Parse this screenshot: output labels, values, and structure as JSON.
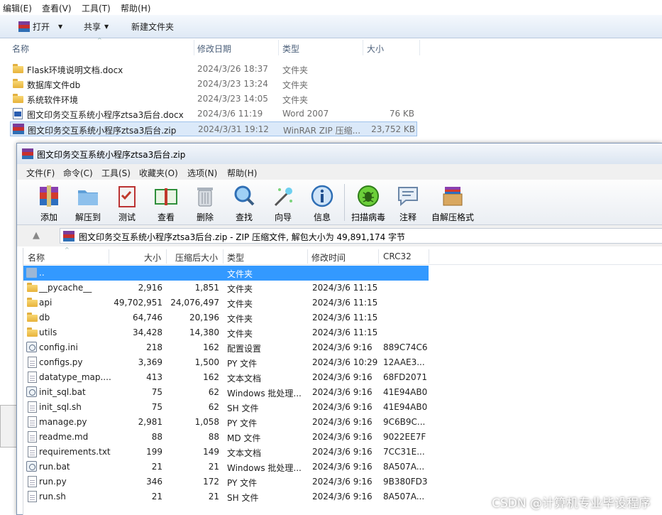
{
  "explorer": {
    "menu": [
      "编辑(E)",
      "查看(V)",
      "工具(T)",
      "帮助(H)"
    ],
    "toolbar": {
      "open": "打开",
      "share": "共享",
      "new_folder": "新建文件夹"
    },
    "columns": {
      "name": "名称",
      "date": "修改日期",
      "type": "类型",
      "size": "大小"
    },
    "rows": [
      {
        "name": "Flask环境说明文档.docx",
        "date": "2024/3/26 18:37",
        "type": "文件夹",
        "size": "",
        "icon": "folder-icon"
      },
      {
        "name": "数据库文件db",
        "date": "2024/3/23 13:24",
        "type": "文件夹",
        "size": "",
        "icon": "folder-icon"
      },
      {
        "name": "系统软件环境",
        "date": "2024/3/23 14:05",
        "type": "文件夹",
        "size": "",
        "icon": "folder-icon"
      },
      {
        "name": "图文印务交互系统小程序ztsa3后台.docx",
        "date": "2024/3/6 11:19",
        "type": "Word 2007",
        "size": "76 KB",
        "icon": "word-doc-icon"
      },
      {
        "name": "图文印务交互系统小程序ztsa3后台.zip",
        "date": "2024/3/31 19:12",
        "type": "WinRAR ZIP 压缩...",
        "size": "23,752 KB",
        "icon": "winrar-zip-icon"
      }
    ]
  },
  "winrar": {
    "title": "图文印务交互系统小程序ztsa3后台.zip",
    "menu": [
      "文件(F)",
      "命令(C)",
      "工具(S)",
      "收藏夹(O)",
      "选项(N)",
      "帮助(H)"
    ],
    "tools": [
      "添加",
      "解压到",
      "测试",
      "查看",
      "删除",
      "查找",
      "向导",
      "信息",
      "扫描病毒",
      "注释",
      "自解压格式"
    ],
    "address": "图文印务交互系统小程序ztsa3后台.zip - ZIP 压缩文件, 解包大小为 49,891,174 字节",
    "columns": {
      "name": "名称",
      "size": "大小",
      "packed": "压缩后大小",
      "type": "类型",
      "modified": "修改时间",
      "crc": "CRC32"
    },
    "rows": [
      {
        "name": "..",
        "size": "",
        "packed": "",
        "type": "文件夹",
        "modified": "",
        "crc": "",
        "icon": "parent-folder-icon"
      },
      {
        "name": "__pycache__",
        "size": "2,916",
        "packed": "1,851",
        "type": "文件夹",
        "modified": "2024/3/6 11:15",
        "crc": "",
        "icon": "folder-icon"
      },
      {
        "name": "api",
        "size": "49,702,951",
        "packed": "24,076,497",
        "type": "文件夹",
        "modified": "2024/3/6 11:15",
        "crc": "",
        "icon": "folder-icon"
      },
      {
        "name": "db",
        "size": "64,746",
        "packed": "20,196",
        "type": "文件夹",
        "modified": "2024/3/6 11:15",
        "crc": "",
        "icon": "folder-icon"
      },
      {
        "name": "utils",
        "size": "34,428",
        "packed": "14,380",
        "type": "文件夹",
        "modified": "2024/3/6 11:15",
        "crc": "",
        "icon": "folder-icon"
      },
      {
        "name": "config.ini",
        "size": "218",
        "packed": "162",
        "type": "配置设置",
        "modified": "2024/3/6 9:16",
        "crc": "889C74C6",
        "icon": "settings-file-icon"
      },
      {
        "name": "configs.py",
        "size": "3,369",
        "packed": "1,500",
        "type": "PY 文件",
        "modified": "2024/3/6 10:29",
        "crc": "12AAE3...",
        "icon": "file-icon"
      },
      {
        "name": "datatype_map....",
        "size": "413",
        "packed": "162",
        "type": "文本文档",
        "modified": "2024/3/6 9:16",
        "crc": "68FD2071",
        "icon": "file-icon"
      },
      {
        "name": "init_sql.bat",
        "size": "75",
        "packed": "62",
        "type": "Windows 批处理...",
        "modified": "2024/3/6 9:16",
        "crc": "41E94AB0",
        "icon": "batch-file-icon"
      },
      {
        "name": "init_sql.sh",
        "size": "75",
        "packed": "62",
        "type": "SH 文件",
        "modified": "2024/3/6 9:16",
        "crc": "41E94AB0",
        "icon": "file-icon"
      },
      {
        "name": "manage.py",
        "size": "2,981",
        "packed": "1,058",
        "type": "PY 文件",
        "modified": "2024/3/6 9:16",
        "crc": "9C6B9C...",
        "icon": "file-icon"
      },
      {
        "name": "readme.md",
        "size": "88",
        "packed": "88",
        "type": "MD 文件",
        "modified": "2024/3/6 9:16",
        "crc": "9022EE7F",
        "icon": "file-icon"
      },
      {
        "name": "requirements.txt",
        "size": "199",
        "packed": "149",
        "type": "文本文档",
        "modified": "2024/3/6 9:16",
        "crc": "7CC31E...",
        "icon": "file-icon"
      },
      {
        "name": "run.bat",
        "size": "21",
        "packed": "21",
        "type": "Windows 批处理...",
        "modified": "2024/3/6 9:16",
        "crc": "8A507A...",
        "icon": "batch-file-icon"
      },
      {
        "name": "run.py",
        "size": "346",
        "packed": "172",
        "type": "PY 文件",
        "modified": "2024/3/6 9:16",
        "crc": "9B380FD3",
        "icon": "file-icon"
      },
      {
        "name": "run.sh",
        "size": "21",
        "packed": "21",
        "type": "SH 文件",
        "modified": "2024/3/6 9:16",
        "crc": "8A507A...",
        "icon": "file-icon"
      }
    ]
  },
  "watermark": "CSDN @计算机专业毕设程序",
  "colors": {
    "selection": "#3399ff",
    "explorer_selection": "#dbe9f9",
    "folder": "#f2c94c"
  }
}
